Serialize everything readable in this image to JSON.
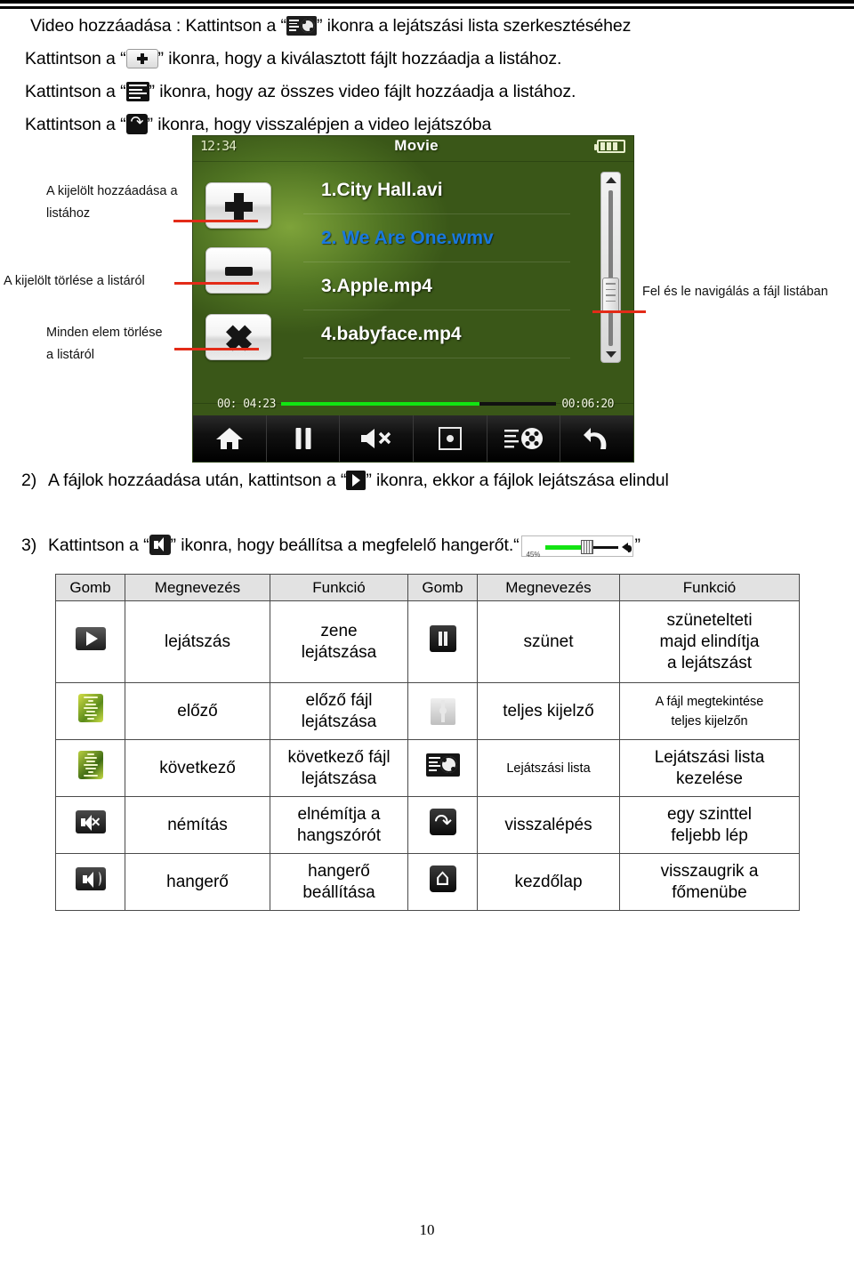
{
  "intro": {
    "line1_a": "Video hozzáadása : Kattintson a “",
    "line1_b": "” ikonra a lejátszási lista szerkesztéséhez",
    "line2_a": "Kattintson a “",
    "line2_b": "” ikonra, hogy a kiválasztott fájlt hozzáadja a listához.",
    "line3_a": "Kattintson a “",
    "line3_b": "” ikonra, hogy az összes video fájlt hozzáadja a listához.",
    "line4_a": "Kattintson a “",
    "line4_b": "” ikonra, hogy visszalépjen a video lejátszóba"
  },
  "device": {
    "time": "12:34",
    "title": "Movie",
    "battery_icon": "battery-icon",
    "files": [
      {
        "label": "1.City Hall.avi",
        "selected": false
      },
      {
        "label": "2. We Are One.wmv",
        "selected": true
      },
      {
        "label": "3.Apple.mp4",
        "selected": false
      },
      {
        "label": "4.babyface.mp4",
        "selected": false
      }
    ],
    "elapsed": "00: 04:23",
    "total": "00:06:20",
    "progress_percent": 72,
    "side_buttons": [
      {
        "name": "add-selected-button",
        "glyph": "plus"
      },
      {
        "name": "remove-selected-button",
        "glyph": "minus"
      },
      {
        "name": "clear-all-button",
        "glyph": "cross"
      }
    ],
    "toolbar": [
      {
        "name": "home-icon"
      },
      {
        "name": "pause-icon"
      },
      {
        "name": "mute-icon"
      },
      {
        "name": "fullscreen-icon"
      },
      {
        "name": "playlist-icon"
      },
      {
        "name": "back-icon"
      }
    ]
  },
  "callouts": {
    "add": "A kijelölt hozzáadása a\nlistához",
    "add_l1": "A kijelölt hozzáadása a",
    "add_l2": "listához",
    "remove": "A kijelölt törlése a listáról",
    "clear_l1": "Minden elem törlése",
    "clear_l2": "a listáról",
    "scroll": "Fel és le navigálás a fájl listában"
  },
  "steps": {
    "s2_num": "2)",
    "s2_a": "A fájlok hozzáadása után, kattintson a “",
    "s2_b": "” ikonra, ekkor a fájlok lejátszása elindul",
    "s3_num": "3)",
    "s3_a": "Kattintson a “",
    "s3_b": "” ikonra,  hogy beállítsa a megfelelő hangerőt.",
    "s3_quote_open": "“",
    "s3_quote_close": "”",
    "volume_percent": "45%"
  },
  "table": {
    "headers": [
      "Gomb",
      "Megnevezés",
      "Funkció",
      "Gomb",
      "Megnevezés",
      "Funkció"
    ],
    "rows": [
      {
        "left_icon": "play-icon",
        "left_name": "lejátszás",
        "left_fn": "zene\nlejátszása",
        "right_icon": "pause-icon",
        "right_name": "szünet",
        "right_fn": "szünetelteti\nmajd elindítja\na lejátszást",
        "left_fn_l1": "zene",
        "left_fn_l2": "lejátszása",
        "right_fn_l1": "szünetelteti",
        "right_fn_l2": "majd elindítja",
        "right_fn_l3": "a lejátszást",
        "right_fn_small": false
      },
      {
        "left_icon": "previous-icon",
        "left_name": "előző",
        "left_fn_l1": "előző fájl",
        "left_fn_l2": "lejátszása",
        "right_icon": "fullscreen-icon",
        "right_name": "teljes kijelző",
        "right_fn_l1": "A fájl megtekintése",
        "right_fn_l2": "teljes kijelzőn",
        "right_fn_small": true
      },
      {
        "left_icon": "next-icon",
        "left_name": "következő",
        "left_fn_l1": "következő fájl",
        "left_fn_l2": "lejátszása",
        "right_icon": "playlist-icon",
        "right_name": "Lejátszási lista",
        "right_fn_l1": "Lejátszási lista",
        "right_fn_l2": "kezelése",
        "right_name_small": true,
        "right_fn_small": false
      },
      {
        "left_icon": "mute-icon",
        "left_name": "némítás",
        "left_fn_l1": "elnémítja a",
        "left_fn_l2": "hangszórót",
        "right_icon": "back-icon",
        "right_name": "visszalépés",
        "right_fn_l1": "egy szinttel",
        "right_fn_l2": "feljebb lép",
        "right_fn_small": false
      },
      {
        "left_icon": "volume-icon",
        "left_name": "hangerő",
        "left_fn_l1": "hangerő",
        "left_fn_l2": "beállítása",
        "right_icon": "home-icon",
        "right_name": "kezdőlap",
        "right_fn_l1": "visszaugrik a",
        "right_fn_l2": "főmenübe",
        "right_fn_small": false
      }
    ]
  },
  "footer": {
    "page_number": "10"
  },
  "colors": {
    "callout_line": "#e32b18",
    "selected_file": "#1878e0",
    "progress_fill": "#12e512",
    "table_header_bg": "#e2e2e2"
  }
}
